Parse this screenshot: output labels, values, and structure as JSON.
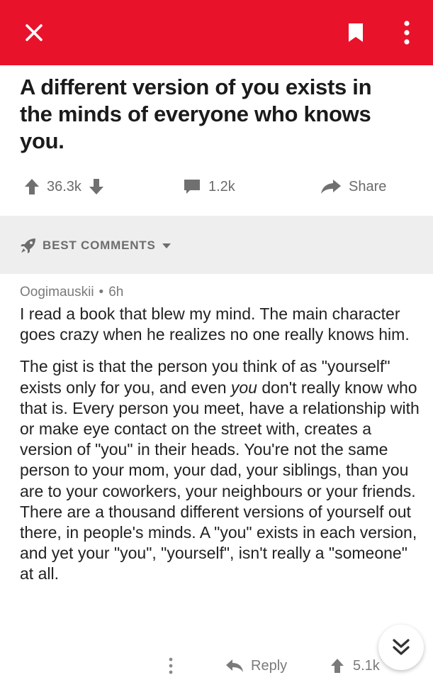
{
  "colors": {
    "header": "#e8132b",
    "sort_bar": "#eeeeee",
    "icon_gray": "#707070"
  },
  "header": {
    "close_icon": "close-icon",
    "bookmark_icon": "bookmark-icon",
    "menu_icon": "more-vertical-icon"
  },
  "post": {
    "title": "A different version of you exists in the minds of everyone who knows you.",
    "score": "36.3k",
    "comments_count": "1.2k",
    "share_label": "Share"
  },
  "sort": {
    "label": "BEST COMMENTS"
  },
  "comment": {
    "author": "Oogimauskii",
    "separator": "•",
    "time": "6h",
    "paragraph1": "I read a book that blew my mind. The main character goes crazy when he realizes no one really knows him.",
    "p2_before": "The gist is that the person you think of as \"yourself\" exists only for you, and even ",
    "p2_emph": "you",
    "p2_after": " don't really know who that is. Every person you meet, have a relationship with or make eye contact on the street with, creates a version of \"you\" in their heads. You're not the same person to your mom, your dad, your siblings, than you are to your coworkers, your neighbours or your friends. There are a thousand different versions of yourself out there, in people's minds. A \"you\" exists in each version, and yet your \"you\", \"yourself\", isn't really a \"someone\" at all.",
    "reply_label": "Reply",
    "score": "5.1k"
  }
}
